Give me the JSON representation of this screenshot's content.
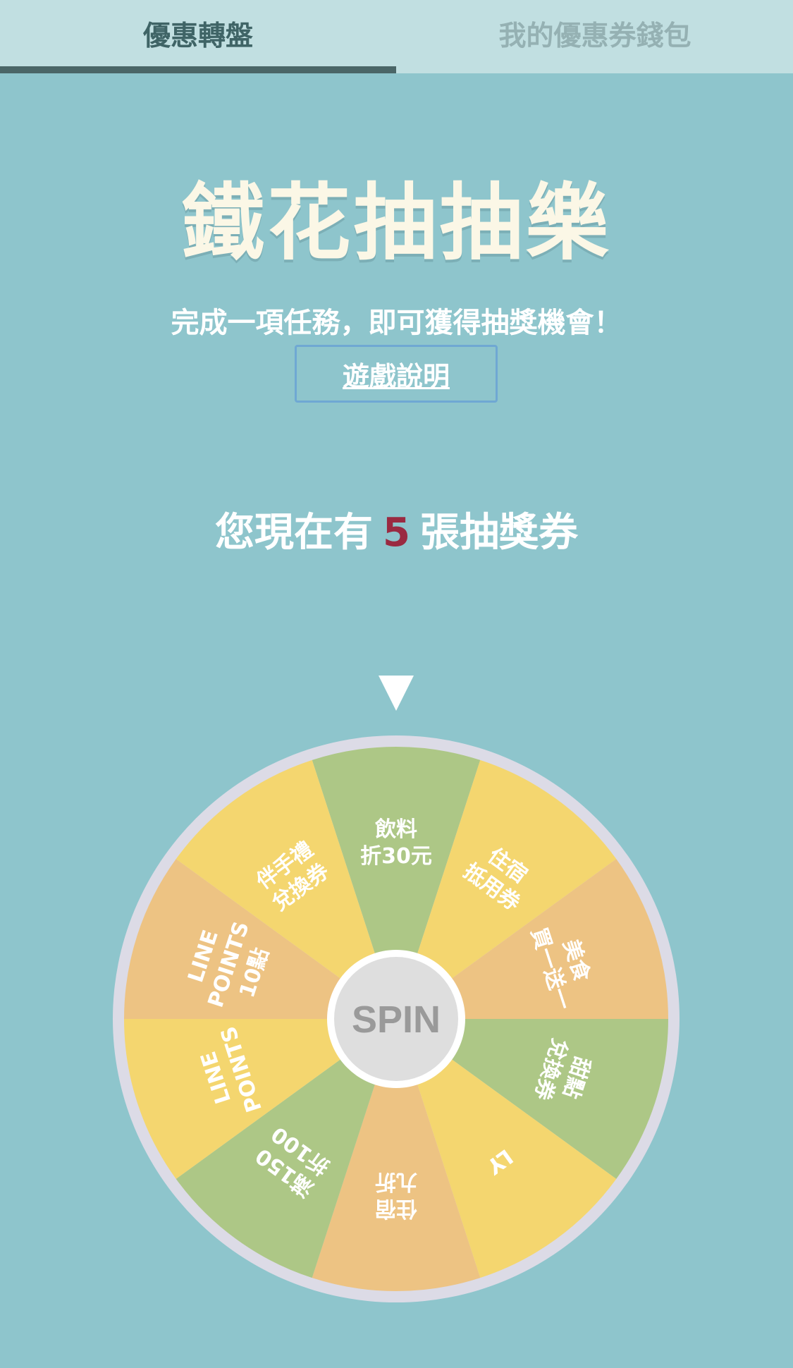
{
  "tabs": [
    {
      "label": "優惠轉盤",
      "active": true
    },
    {
      "label": "我的優惠券錢包",
      "active": false
    }
  ],
  "title": "鐵花抽抽樂",
  "subtitle": "完成一項任務，即可獲得抽獎機會！",
  "rules_button": "遊戲說明",
  "tickets": {
    "prefix": "您現在有",
    "count": "5",
    "suffix": "張抽獎券"
  },
  "wheel": {
    "spin_label": "SPIN",
    "pointer_icon": "triangle-down-icon",
    "segments": [
      {
        "lines": [
          "飲料",
          "折30元"
        ],
        "color": "#adc786"
      },
      {
        "lines": [
          "住宿",
          "抵用券"
        ],
        "color": "#f4d66f"
      },
      {
        "lines": [
          "美食",
          "買一送一"
        ],
        "color": "#edc383"
      },
      {
        "lines": [
          "甜點",
          "兌換券"
        ],
        "color": "#adc786"
      },
      {
        "lines": [
          "LY"
        ],
        "color": "#f4d66f"
      },
      {
        "lines": [
          "住宿",
          "九折"
        ],
        "color": "#edc383"
      },
      {
        "lines": [
          "滿150",
          "折100"
        ],
        "color": "#adc786"
      },
      {
        "lines": [
          "LINE",
          "POINTS"
        ],
        "color": "#f4d66f"
      },
      {
        "lines": [
          "LINE",
          "POINTS",
          "10點"
        ],
        "color": "#edc383"
      },
      {
        "lines": [
          "伴手禮",
          "兌換券"
        ],
        "color": "#f4d66f"
      }
    ]
  },
  "colors": {
    "background": "#8ec5cc",
    "rim": "#dcdbe6",
    "ticket_count": "#9a2a41"
  }
}
